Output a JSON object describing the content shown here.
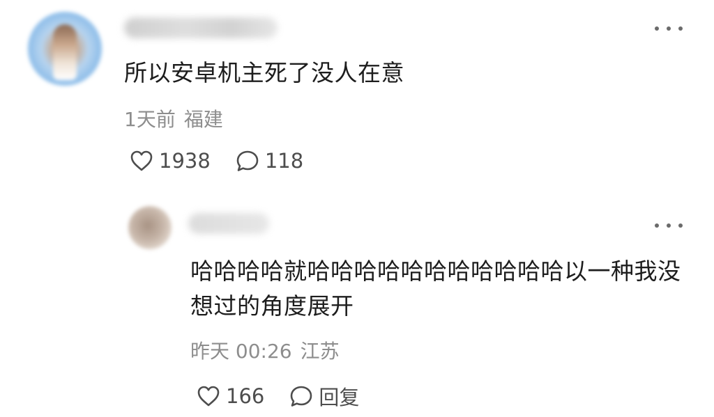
{
  "comment": {
    "text": "所以安卓机主死了没人在意",
    "time": "1天前",
    "location": "福建",
    "likes": "1938",
    "replies": "118",
    "icons": [
      "heart-icon",
      "comment-bubble-icon",
      "more-dots-icon"
    ]
  },
  "reply": {
    "text": "哈哈哈哈就哈哈哈哈哈哈哈哈哈哈哈以一种我没想过的角度展开",
    "time": "昨天 00:26",
    "location": "江苏",
    "likes": "166",
    "reply_label": "回复",
    "icons": [
      "heart-icon",
      "comment-bubble-icon",
      "more-dots-icon"
    ]
  },
  "colors": {
    "text": "#1d1d1d",
    "meta": "#8d8d8d",
    "icon": "#4d4d4d"
  }
}
